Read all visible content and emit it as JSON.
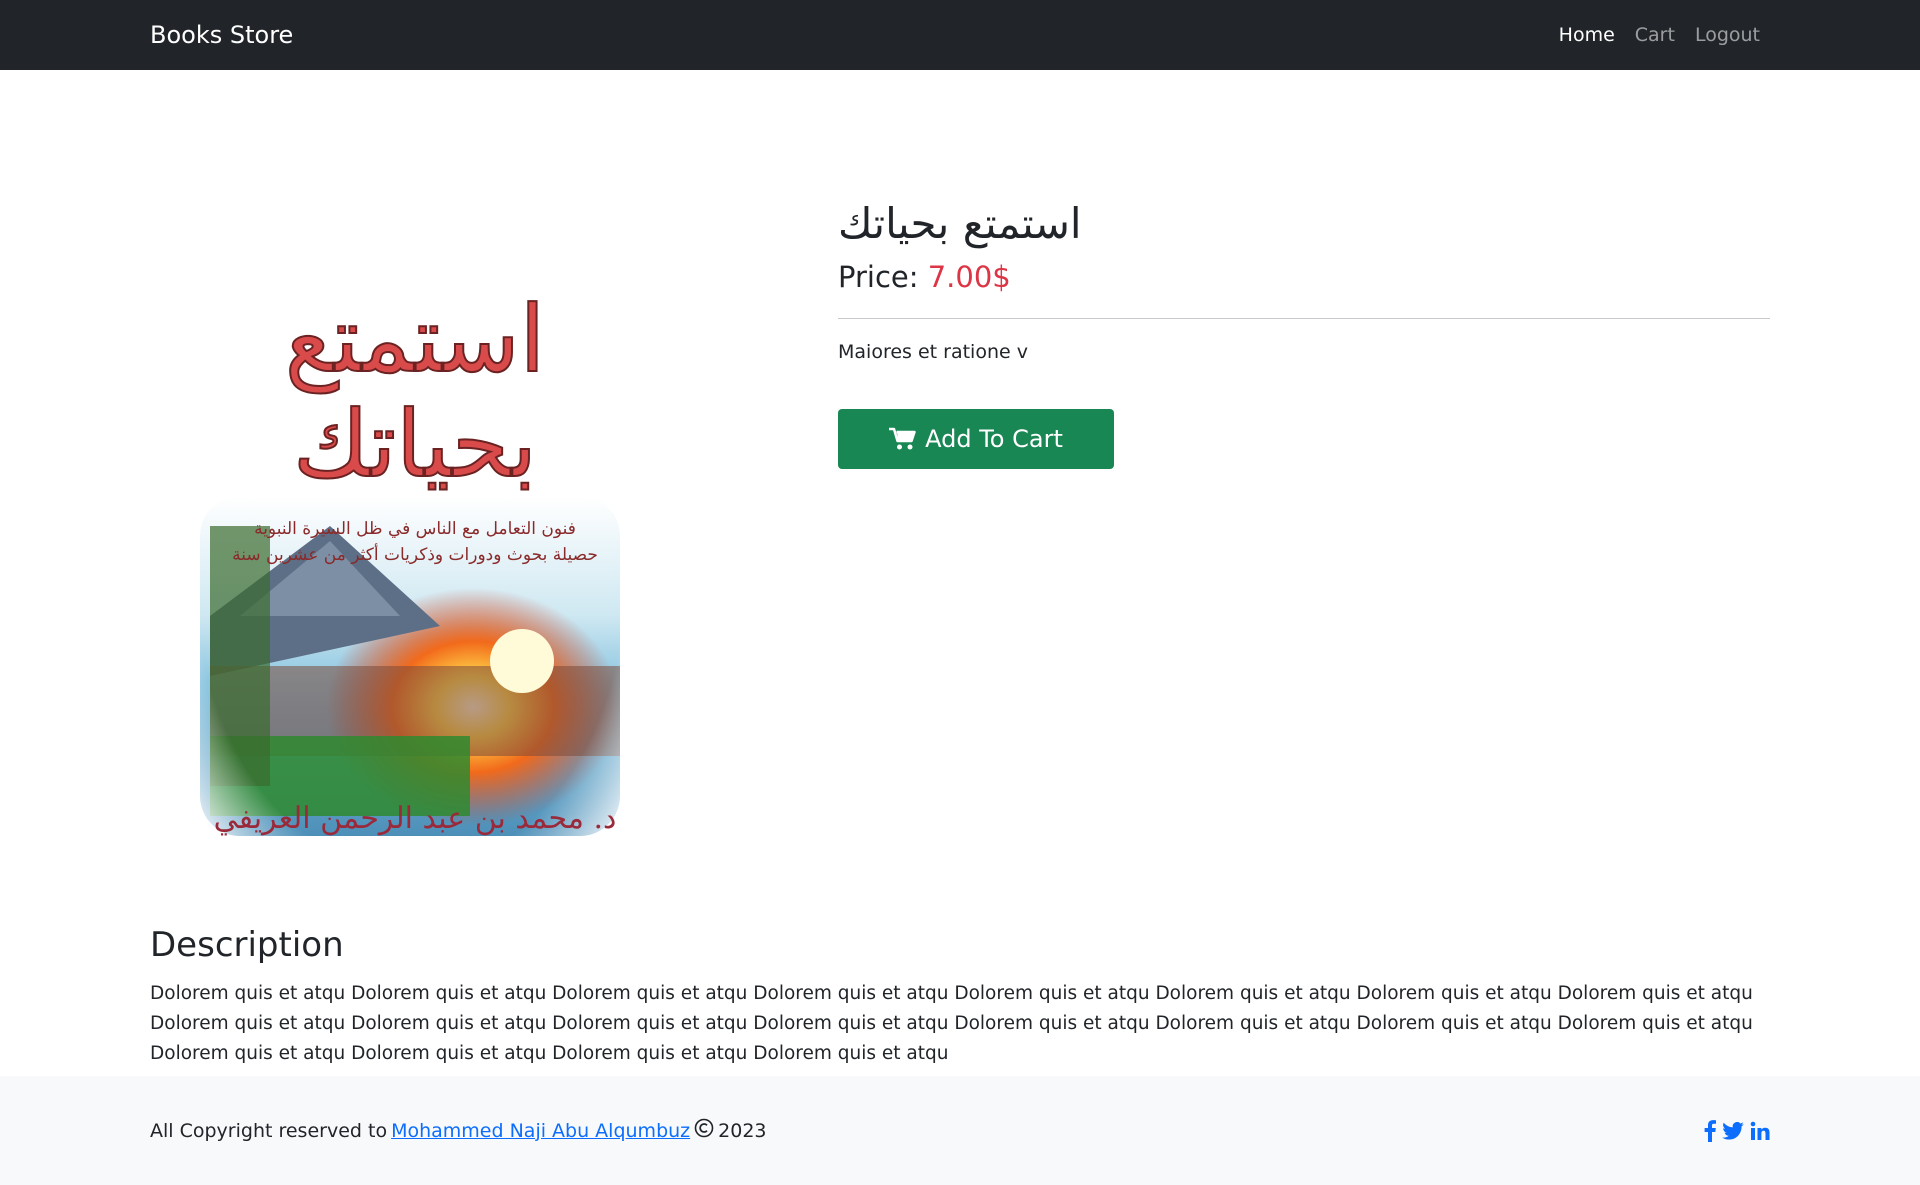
{
  "navbar": {
    "brand": "Books Store",
    "links": [
      "Home",
      "Cart",
      "Logout"
    ]
  },
  "product": {
    "title": "استمتع بحياتك",
    "price_label": "Price:",
    "price_value": "7.00$",
    "short_description": "Maiores et ratione v",
    "add_to_cart": "Add To Cart",
    "cover": {
      "title_line1": "استمتع",
      "title_line2": "بحياتك",
      "subtitle_line1": "فنون التعامل مع الناس في ظل السيرة النبوية",
      "subtitle_line2": "حصيلة بحوث ودورات وذكريات أكثر من عشرين سنة",
      "author": "د. محمد بن عبد الرحمن العريفي"
    }
  },
  "description": {
    "heading": "Description",
    "text": "Dolorem quis et atqu Dolorem quis et atqu Dolorem quis et atqu Dolorem quis et atqu Dolorem quis et atqu Dolorem quis et atqu Dolorem quis et atqu Dolorem quis et atqu Dolorem quis et atqu Dolorem quis et atqu Dolorem quis et atqu Dolorem quis et atqu Dolorem quis et atqu Dolorem quis et atqu Dolorem quis et atqu Dolorem quis et atqu Dolorem quis et atqu Dolorem quis et atqu Dolorem quis et atqu Dolorem quis et atqu"
  },
  "footer": {
    "copyright_prefix": "All Copyright reserved to",
    "author_link": "Mohammed Naji Abu Alqumbuz",
    "year": "2023"
  },
  "colors": {
    "navbar_bg": "#212529",
    "price": "#dc3545",
    "button": "#198754",
    "link": "#0d6efd",
    "footer_bg": "#f8f9fa"
  },
  "icons": [
    "cart-icon",
    "copyright-icon",
    "facebook-icon",
    "twitter-icon",
    "linkedin-icon"
  ]
}
